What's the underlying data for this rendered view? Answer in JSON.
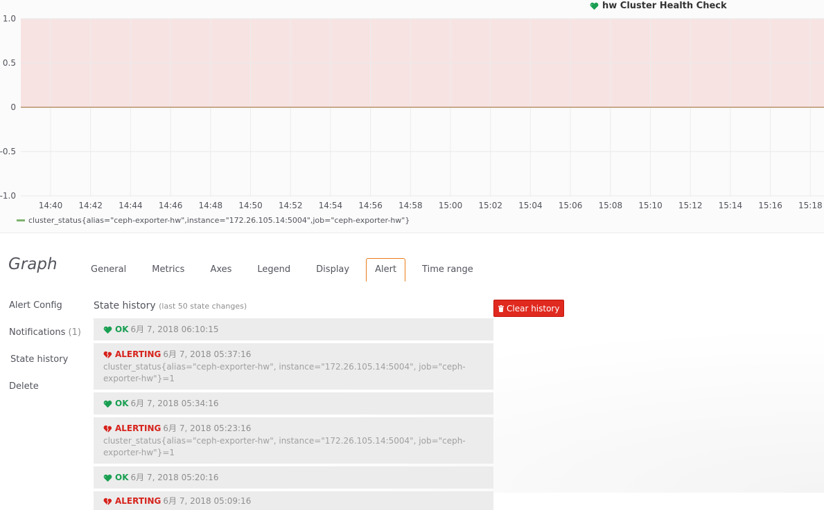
{
  "panel": {
    "title": "hw Cluster Health Check"
  },
  "chart_data": {
    "type": "line",
    "title": "hw Cluster Health Check",
    "ylim": [
      -1.0,
      1.0
    ],
    "y_ticks": [
      "1.0",
      "0.5",
      "0",
      "-0.5",
      "-1.0"
    ],
    "x_ticks": [
      "14:40",
      "14:42",
      "14:44",
      "14:46",
      "14:48",
      "14:50",
      "14:52",
      "14:54",
      "14:56",
      "14:58",
      "15:00",
      "15:02",
      "15:04",
      "15:06",
      "15:08",
      "15:10",
      "15:12",
      "15:14",
      "15:16",
      "15:18"
    ],
    "threshold": {
      "op": "gt",
      "value": 0,
      "fill": "#f8e3e3"
    },
    "series": [
      {
        "name": "cluster_status{alias=\"ceph-exporter-hw\",instance=\"172.26.105.14:5004\",job=\"ceph-exporter-hw\"}",
        "values": [
          0,
          0,
          0,
          0,
          0,
          0,
          0,
          0,
          0,
          0,
          0,
          0,
          0,
          0,
          0,
          0,
          0,
          0,
          0,
          0
        ],
        "color": "#7eb26d",
        "line_color": "#c7a98a"
      }
    ],
    "grid": true,
    "legend": "bottom-left"
  },
  "legend": {
    "series_label": "cluster_status{alias=\"ceph-exporter-hw\",instance=\"172.26.105.14:5004\",job=\"ceph-exporter-hw\"}"
  },
  "editor": {
    "title": "Graph",
    "tabs": [
      {
        "label": "General"
      },
      {
        "label": "Metrics"
      },
      {
        "label": "Axes"
      },
      {
        "label": "Legend"
      },
      {
        "label": "Display"
      },
      {
        "label": "Alert",
        "active": true
      },
      {
        "label": "Time range"
      }
    ],
    "sidenav": [
      {
        "label": "Alert Config",
        "count": ""
      },
      {
        "label": "Notifications",
        "count": "(1)"
      },
      {
        "label": "State history",
        "count": "",
        "active": true
      },
      {
        "label": "Delete",
        "count": ""
      }
    ]
  },
  "history": {
    "title": "State history",
    "subtitle": "(last 50 state changes)",
    "clear_label": "Clear history",
    "entries": [
      {
        "state": "OK",
        "kind": "ok",
        "time": "6月 7, 2018 06:10:15",
        "info": ""
      },
      {
        "state": "ALERTING",
        "kind": "alerting",
        "time": "6月 7, 2018 05:37:16",
        "info": "cluster_status{alias=\"ceph-exporter-hw\", instance=\"172.26.105.14:5004\", job=\"ceph-exporter-hw\"}=1"
      },
      {
        "state": "OK",
        "kind": "ok",
        "time": "6月 7, 2018 05:34:16",
        "info": ""
      },
      {
        "state": "ALERTING",
        "kind": "alerting",
        "time": "6月 7, 2018 05:23:16",
        "info": "cluster_status{alias=\"ceph-exporter-hw\", instance=\"172.26.105.14:5004\", job=\"ceph-exporter-hw\"}=1"
      },
      {
        "state": "OK",
        "kind": "ok",
        "time": "6月 7, 2018 05:20:16",
        "info": ""
      },
      {
        "state": "ALERTING",
        "kind": "alerting",
        "time": "6月 7, 2018 05:09:16",
        "info": ""
      }
    ]
  },
  "colors": {
    "ok": "#1a9f52",
    "alerting": "#d6221b",
    "accent_tab": "#eb7b18",
    "danger_button": "#e0291f"
  },
  "icons": {
    "ok": "heart-icon",
    "alerting": "broken-heart-icon",
    "clear": "trash-icon"
  }
}
